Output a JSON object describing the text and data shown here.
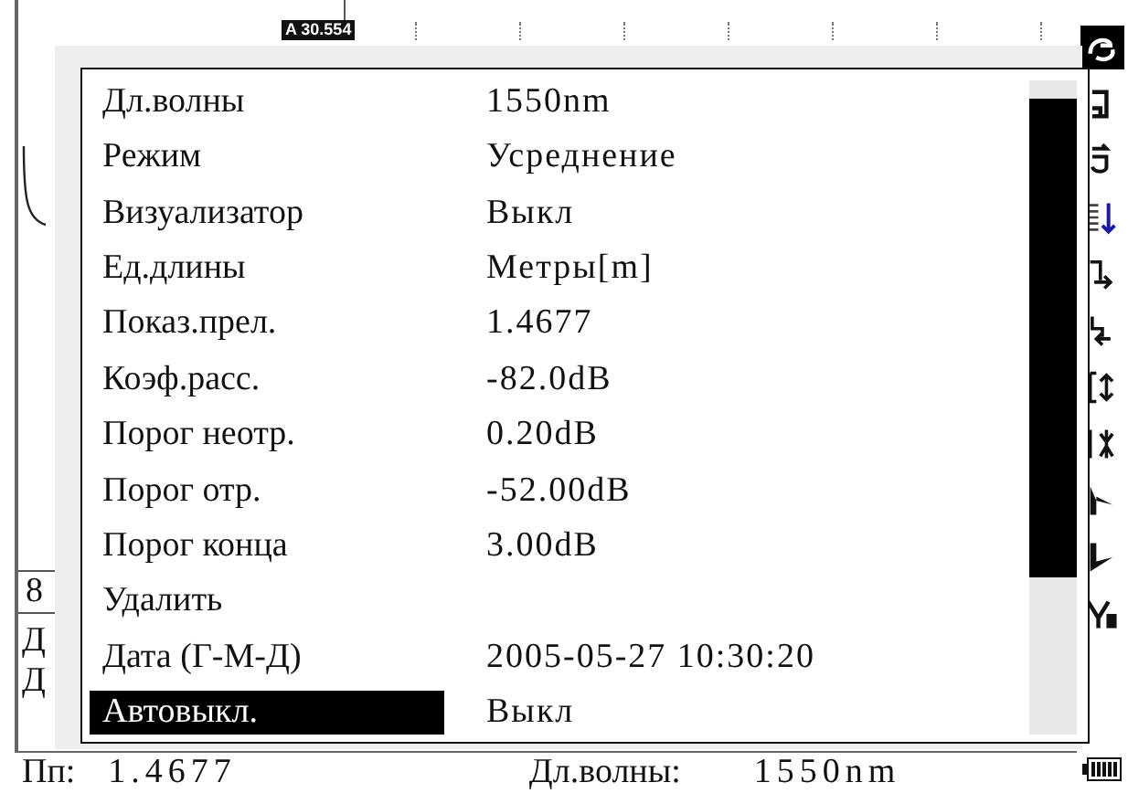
{
  "trace": {
    "marker": "A 30.554",
    "side_texts": [
      "8",
      "Д",
      "Д"
    ]
  },
  "settings": {
    "rows": [
      {
        "label": "Дл.волны",
        "value": "1550nm",
        "selected": false
      },
      {
        "label": "Режим",
        "value": "Усреднение",
        "selected": false
      },
      {
        "label": "Визуализатор",
        "value": "Выкл",
        "selected": false
      },
      {
        "label": "Ед.длины",
        "value": "Метры[m]",
        "selected": false
      },
      {
        "label": "Показ.прел.",
        "value": "1.4677",
        "selected": false
      },
      {
        "label": "Коэф.расс.",
        "value": "-82.0dB",
        "selected": false
      },
      {
        "label": "Порог неотр.",
        "value": "0.20dB",
        "selected": false
      },
      {
        "label": "Порог отр.",
        "value": "-52.00dB",
        "selected": false
      },
      {
        "label": "Порог конца",
        "value": "3.00dB",
        "selected": false
      },
      {
        "label": "Удалить",
        "selected": false
      },
      {
        "label": "Дата (Г-М-Д)",
        "value": "2005-05-27 10:30:20",
        "selected": false
      },
      {
        "label": "Автовыкл.",
        "value": "Выкл",
        "selected": true
      }
    ]
  },
  "toolbar": [
    {
      "selected": true
    },
    {
      "selected": false
    },
    {
      "selected": false
    },
    {
      "selected": false
    },
    {
      "selected": false
    },
    {
      "selected": false
    },
    {
      "selected": false
    },
    {
      "selected": false
    },
    {
      "selected": false
    },
    {
      "selected": false
    },
    {
      "selected": false
    }
  ],
  "status_bar": {
    "ior_label": "Пп:",
    "ior_value": "1.4677",
    "wavelength_label": "Дл.волны:",
    "wavelength_value": "1550nm"
  }
}
